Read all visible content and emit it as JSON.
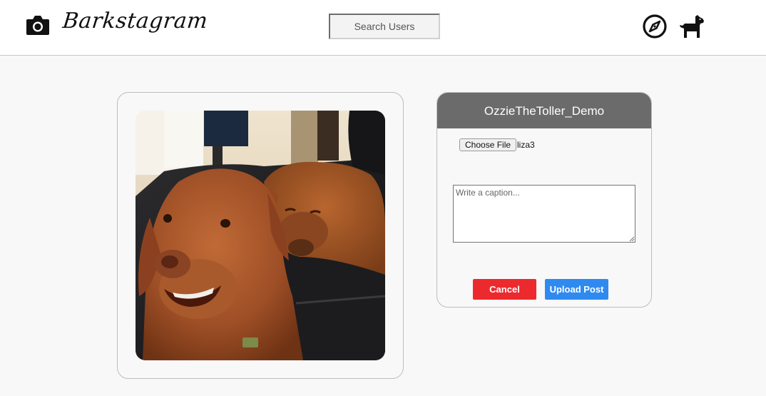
{
  "header": {
    "brand": "Barkstagram",
    "search": {
      "placeholder": "Search Users",
      "value": ""
    },
    "icons": {
      "camera": "camera-icon",
      "explore": "compass-icon",
      "profile": "dog-icon"
    }
  },
  "post_preview": {
    "image_alt": "Two Nova Scotia duck tolling retrievers on a leather couch"
  },
  "upload_form": {
    "username": "OzzieTheToller_Demo",
    "choose_file_label": "Choose File",
    "file_name": "liza3",
    "caption": {
      "placeholder": "Write a caption...",
      "value": ""
    },
    "cancel_label": "Cancel",
    "upload_label": "Upload Post"
  },
  "colors": {
    "header_bg": "#ffffff",
    "page_bg": "#f8f8f8",
    "form_header_bg": "#6b6b6b",
    "cancel": "#ec2a2e",
    "upload": "#2f8af0"
  }
}
